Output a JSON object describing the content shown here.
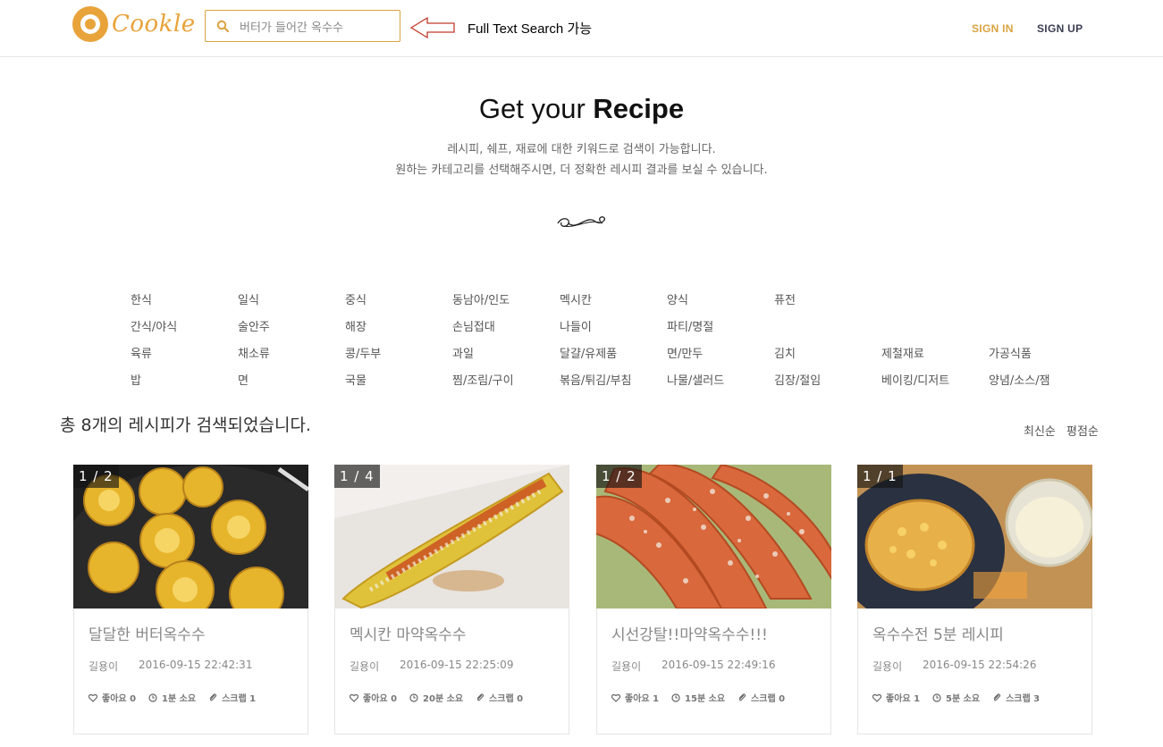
{
  "header": {
    "logo_text": "Cookle",
    "search_value": "버터가 들어간 옥수수",
    "annotation": "Full Text Search 가능",
    "signin": "SIGN IN",
    "signup": "SIGN UP"
  },
  "hero": {
    "title_light": "Get your ",
    "title_bold": "Recipe",
    "desc_line1": "레시피, 쉐프, 재료에 대한 키워드로 검색이 가능합니다.",
    "desc_line2": "원하는 카테고리를 선택해주시면, 더 정확한 레시피 결과를 보실 수 있습니다."
  },
  "categories": [
    [
      "한식",
      "일식",
      "중식",
      "동남아/인도",
      "멕시칸",
      "양식",
      "퓨전"
    ],
    [
      "간식/야식",
      "술안주",
      "해장",
      "손님접대",
      "나들이",
      "파티/명절"
    ],
    [
      "육류",
      "채소류",
      "콩/두부",
      "과일",
      "달걀/유제품",
      "면/만두",
      "김치",
      "제철재료",
      "가공식품"
    ],
    [
      "밥",
      "면",
      "국물",
      "찜/조림/구이",
      "볶음/튀김/부침",
      "나물/샐러드",
      "김장/절임",
      "베이킹/디저트",
      "양념/소스/잼"
    ]
  ],
  "results": {
    "count_text": "총 8개의 레시피가 검색되었습니다.",
    "sort_latest": "최신순",
    "sort_rating": "평점순"
  },
  "cards": [
    {
      "counter": "1 / 2",
      "title": "달달한 버터옥수수",
      "author": "길용이",
      "date": "2016-09-15 22:42:31",
      "likes": "좋아요 0",
      "time": "1분 소요",
      "scrap": "스크랩 1"
    },
    {
      "counter": "1 / 4",
      "title": "멕시칸 마약옥수수",
      "author": "길용이",
      "date": "2016-09-15 22:25:09",
      "likes": "좋아요 0",
      "time": "20분 소요",
      "scrap": "스크랩 0"
    },
    {
      "counter": "1 / 2",
      "title": "시선강탈!!마약옥수수!!!",
      "author": "길용이",
      "date": "2016-09-15 22:49:16",
      "likes": "좋아요 1",
      "time": "15분 소요",
      "scrap": "스크랩 0"
    },
    {
      "counter": "1 / 1",
      "title": "옥수수전 5분 레시피",
      "author": "길용이",
      "date": "2016-09-15 22:54:26",
      "likes": "좋아요 1",
      "time": "5분 소요",
      "scrap": "스크랩 3"
    }
  ],
  "colors": {
    "accent": "#d9a23f",
    "navy": "#3a3f51"
  },
  "icons": [
    "search-icon",
    "arrow-left-icon",
    "flourish-icon",
    "heart-icon",
    "clock-icon",
    "paperclip-icon"
  ]
}
